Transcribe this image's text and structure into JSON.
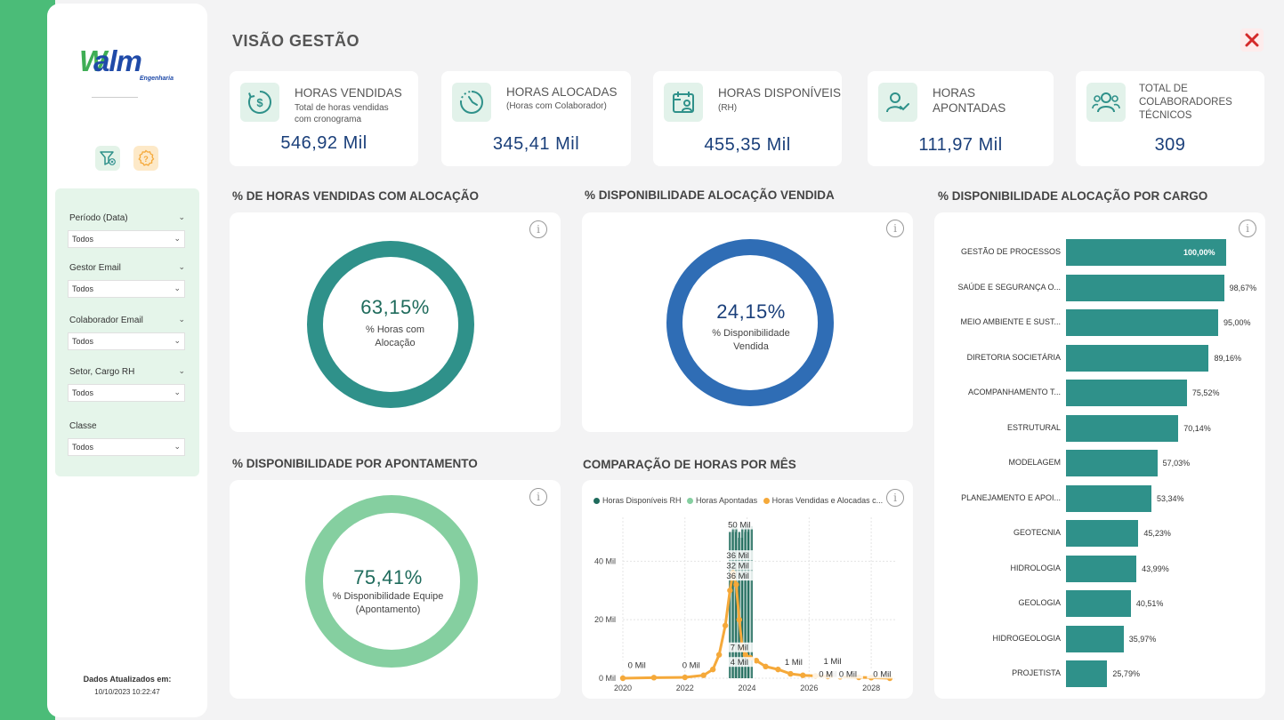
{
  "sidebar": {
    "logo": {
      "text": "alm",
      "w": "W",
      "sub": "Engenharia"
    },
    "filters": [
      {
        "label": "Período (Data)",
        "value": "Todos"
      },
      {
        "label": "Gestor Email",
        "value": "Todos"
      },
      {
        "label": "Colaborador Email",
        "value": "Todos"
      },
      {
        "label": "Setor, Cargo RH",
        "value": "Todos"
      },
      {
        "label": "Classe",
        "value": "Todos"
      }
    ],
    "updated_label": "Dados Atualizados em:",
    "updated_value": "10/10/2023 10:22:47"
  },
  "header": {
    "title": "VISÃO GESTÃO"
  },
  "kpis": [
    {
      "title_lines": [
        "HORAS VENDIDAS"
      ],
      "sub_lines": [
        "Total de horas vendidas",
        "com cronograma"
      ],
      "value": "546,92 Mil",
      "icon": "dollar-icon"
    },
    {
      "title_lines": [
        "HORAS ALOCADAS"
      ],
      "sub_lines": [
        "(Horas com Colaborador)"
      ],
      "value": "345,41 Mil",
      "icon": "clock-icon"
    },
    {
      "title_lines": [
        "HORAS DISPONÍVEIS"
      ],
      "sub_lines": [
        "(RH)"
      ],
      "value": "455,35 Mil",
      "icon": "calendar-user-icon"
    },
    {
      "title_lines": [
        "HORAS",
        "APONTADAS"
      ],
      "sub_lines": [],
      "value": "111,97 Mil",
      "icon": "user-check-icon"
    },
    {
      "title_lines": [
        "TOTAL DE",
        "COLABORADORES",
        "TÉCNICOS"
      ],
      "sub_lines": [],
      "value": "309",
      "icon": "users-icon"
    }
  ],
  "donuts": {
    "vendidas": {
      "title": "% DE HORAS VENDIDAS COM ALOCAÇÃO",
      "value": "63,15%",
      "label_lines": [
        "% Horas com",
        "Alocação"
      ],
      "color": "#2f918a"
    },
    "disponibilidade": {
      "title": "% DISPONIBILIDADE ALOCAÇÃO VENDIDA",
      "value": "24,15%",
      "label_lines": [
        "% Disponibilidade",
        "Vendida"
      ],
      "color": "#2f6db5"
    },
    "apontamento": {
      "title": "% DISPONIBILIDADE POR APONTAMENTO",
      "value": "75,41%",
      "label_lines": [
        "% Disponibilidade Equipe",
        "(Apontamento)"
      ],
      "color": "#85cfa0"
    }
  },
  "cargo_chart": {
    "title": "% DISPONIBILIDADE ALOCAÇÃO POR CARGO",
    "chart_data": {
      "type": "bar",
      "orientation": "horizontal",
      "categories": [
        "GESTÃO DE PROCESSOS",
        "SAÚDE E SEGURANÇA O...",
        "MEIO AMBIENTE E SUST...",
        "DIRETORIA SOCIETÁRIA",
        "ACOMPANHAMENTO T...",
        "ESTRUTURAL",
        "MODELAGEM",
        "PLANEJAMENTO E APOI...",
        "GEOTECNIA",
        "HIDROLOGIA",
        "GEOLOGIA",
        "HIDROGEOLOGIA",
        "PROJETISTA"
      ],
      "values": [
        100.0,
        98.67,
        95.0,
        89.16,
        75.52,
        70.14,
        57.03,
        53.34,
        45.23,
        43.99,
        40.51,
        35.97,
        25.79
      ],
      "labels": [
        "100,00%",
        "98,67%",
        "95,00%",
        "89,16%",
        "75,52%",
        "70,14%",
        "57,03%",
        "53,34%",
        "45,23%",
        "43,99%",
        "40,51%",
        "35,97%",
        "25,79%"
      ],
      "xlim": [
        0,
        100
      ],
      "color": "#2f918a"
    }
  },
  "month_chart": {
    "title": "COMPARAÇÃO DE HORAS POR MÊS",
    "legend": [
      {
        "name": "Horas Disponíveis RH",
        "color": "#1f6b5c"
      },
      {
        "name": "Horas Apontadas",
        "color": "#85cfa0"
      },
      {
        "name": "Horas Vendidas e Alocadas c...",
        "color": "#f5a93a"
      }
    ],
    "chart_data": {
      "type": "line",
      "x_ticks": [
        "2020",
        "2022",
        "2024",
        "2026",
        "2028"
      ],
      "y_ticks": [
        "0 Mil",
        "20 Mil",
        "40 Mil"
      ],
      "ylim": [
        0,
        55
      ],
      "xlim": [
        2020,
        2028.8
      ],
      "series": [
        {
          "name": "Horas Vendidas e Alocadas c...",
          "points": [
            [
              2020.0,
              0
            ],
            [
              2021.0,
              0.2
            ],
            [
              2022.0,
              0.3
            ],
            [
              2022.6,
              1
            ],
            [
              2022.9,
              3
            ],
            [
              2023.1,
              8
            ],
            [
              2023.3,
              18
            ],
            [
              2023.45,
              30
            ],
            [
              2023.55,
              36
            ],
            [
              2023.65,
              32
            ],
            [
              2023.75,
              20
            ],
            [
              2023.85,
              10
            ],
            [
              2023.95,
              8
            ],
            [
              2024.1,
              7
            ],
            [
              2024.3,
              6
            ],
            [
              2024.6,
              4
            ],
            [
              2025.0,
              3
            ],
            [
              2025.4,
              1.5
            ],
            [
              2025.8,
              1
            ],
            [
              2026.2,
              0.8
            ],
            [
              2026.6,
              0.6
            ],
            [
              2027.0,
              0.5
            ],
            [
              2027.6,
              0.3
            ],
            [
              2028.0,
              0.2
            ],
            [
              2028.6,
              0
            ]
          ]
        },
        {
          "name": "Horas Disponíveis RH",
          "bars_x": [
            2023.5,
            2023.6,
            2023.7,
            2023.8,
            2023.9,
            2024.0,
            2024.1
          ],
          "bars_y": [
            50,
            52,
            50,
            48,
            52,
            50,
            52
          ]
        }
      ],
      "data_labels": [
        "50 Mil",
        "36 Mil",
        "32 Mil",
        "36 Mil",
        "7 Mil",
        "4 Mil",
        "0 Mil",
        "0 Mil",
        "1 Mil",
        "0 Mil",
        "1 Mil",
        "0 Mil",
        "0 Mil"
      ]
    }
  }
}
